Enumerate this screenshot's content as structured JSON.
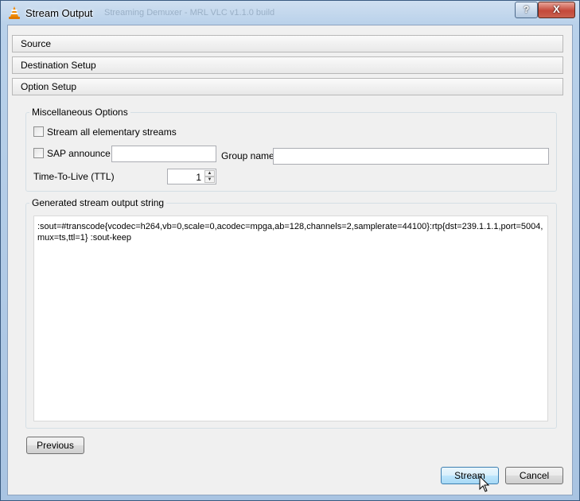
{
  "window": {
    "title": "Stream Output",
    "ghost_title": "Streaming Demuxer  -  MRL  VLC  v1.1.0  build",
    "help_glyph": "?",
    "close_glyph": "X"
  },
  "sections": {
    "source": "Source",
    "destination": "Destination Setup",
    "option": "Option Setup"
  },
  "misc": {
    "title": "Miscellaneous Options",
    "stream_all_label": "Stream all elementary streams",
    "stream_all_checked": false,
    "sap_label": "SAP announce",
    "sap_checked": false,
    "sap_value": "",
    "group_name_label": "Group name",
    "group_name_value": "",
    "ttl_label": "Time-To-Live (TTL)",
    "ttl_value": "1"
  },
  "output": {
    "title": "Generated stream output string",
    "text": ":sout=#transcode{vcodec=h264,vb=0,scale=0,acodec=mpga,ab=128,channels=2,samplerate=44100}:rtp{dst=239.1.1.1,port=5004,mux=ts,ttl=1} :sout-keep"
  },
  "buttons": {
    "previous": "Previous",
    "stream": "Stream",
    "cancel": "Cancel"
  },
  "icons": {
    "app": "vlc-cone-icon",
    "cursor": "mouse-pointer-icon"
  },
  "colors": {
    "vlc_orange": "#f08a00",
    "default_button_border": "#3c7fb1"
  }
}
